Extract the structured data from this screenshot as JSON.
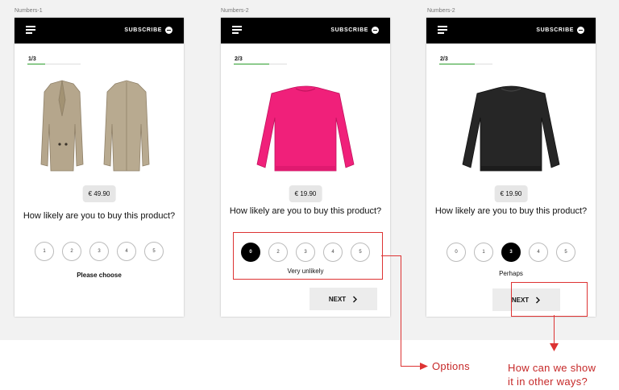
{
  "frames": [
    {
      "label": "Numbers-1",
      "subscribe": "SUBSCRIBE",
      "progress": "1/3",
      "progress_fraction": 0.33,
      "price": "€ 49.90",
      "question": "How likely are you to buy this product?",
      "options": [
        "1",
        "2",
        "3",
        "4",
        "5"
      ],
      "selected": null,
      "feedback": "Please choose"
    },
    {
      "label": "Numbers-2",
      "subscribe": "SUBSCRIBE",
      "progress": "2/3",
      "progress_fraction": 0.66,
      "price": "€ 19.90",
      "question": "How likely are you to buy this product?",
      "options": [
        "0",
        "2",
        "3",
        "4",
        "5"
      ],
      "selected": "0",
      "feedback": "Very unlikely",
      "next": "NEXT"
    },
    {
      "label": "Numbers-2",
      "subscribe": "SUBSCRIBE",
      "progress": "2/3",
      "progress_fraction": 0.66,
      "price": "€ 19.90",
      "question": "How likely are you to buy this product?",
      "options": [
        "0",
        "1",
        "3",
        "4",
        "5"
      ],
      "selected": "3",
      "feedback": "Perhaps",
      "next": "NEXT"
    }
  ],
  "annotations": {
    "options": "Options",
    "next_question_line1": "How can we show",
    "next_question_line2": "it in other ways?"
  },
  "colors": {
    "annotation": "#d33333",
    "progress": "#2a9d2a",
    "header": "#000000",
    "pink": "#f0207a",
    "coat": "#b5a68c"
  },
  "icons": [
    "menu-icon",
    "subscribe-icon",
    "chevron-right-icon",
    "arrow-right-icon",
    "arrow-down-icon"
  ]
}
